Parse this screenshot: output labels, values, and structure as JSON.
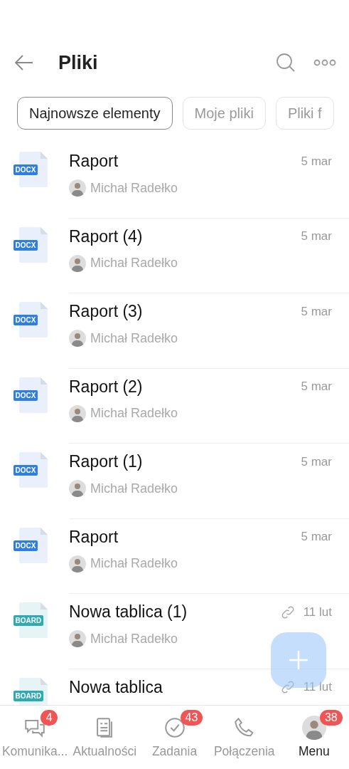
{
  "header": {
    "title": "Pliki"
  },
  "filters": [
    {
      "label": "Najnowsze elementy",
      "selected": true
    },
    {
      "label": "Moje pliki",
      "selected": false
    },
    {
      "label": "Pliki f",
      "selected": false
    }
  ],
  "files": [
    {
      "kind": "docx",
      "type_label": "DOCX",
      "name": "Raport",
      "date": "5 mar",
      "shared": false,
      "author": "Michał Radełko"
    },
    {
      "kind": "docx",
      "type_label": "DOCX",
      "name": "Raport (4)",
      "date": "5 mar",
      "shared": false,
      "author": "Michał Radełko"
    },
    {
      "kind": "docx",
      "type_label": "DOCX",
      "name": "Raport (3)",
      "date": "5 mar",
      "shared": false,
      "author": "Michał Radełko"
    },
    {
      "kind": "docx",
      "type_label": "DOCX",
      "name": "Raport (2)",
      "date": "5 mar",
      "shared": false,
      "author": "Michał Radełko"
    },
    {
      "kind": "docx",
      "type_label": "DOCX",
      "name": "Raport (1)",
      "date": "5 mar",
      "shared": false,
      "author": "Michał Radełko"
    },
    {
      "kind": "docx",
      "type_label": "DOCX",
      "name": "Raport",
      "date": "5 mar",
      "shared": false,
      "author": "Michał Radełko"
    },
    {
      "kind": "board",
      "type_label": "BOARD",
      "name": "Nowa tablica (1)",
      "date": "11 lut",
      "shared": true,
      "author": "Michał Radełko"
    },
    {
      "kind": "board",
      "type_label": "BOARD",
      "name": "Nowa tablica",
      "date": "11 lut",
      "shared": true
    }
  ],
  "nav": [
    {
      "kind": "chat",
      "label": "Komunika...",
      "badge": "4",
      "selected": false
    },
    {
      "kind": "news",
      "label": "Aktualności",
      "selected": false
    },
    {
      "kind": "tasks",
      "label": "Zadania",
      "badge": "43",
      "selected": false
    },
    {
      "kind": "calls",
      "label": "Połączenia",
      "selected": false
    },
    {
      "kind": "avatar",
      "label": "Menu",
      "badge": "38",
      "selected": true
    }
  ]
}
